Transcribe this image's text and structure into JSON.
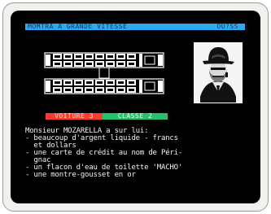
{
  "title_bar": {
    "title": "MOMTRA A GRANDE VITESSE",
    "right": "OU?SS",
    "color": "#2ea8ee"
  },
  "train": {
    "car_count": 2,
    "color": "#ffffff"
  },
  "portrait": {
    "icon": "detective-portrait-icon"
  },
  "badges": {
    "car": "VOITURE 3",
    "class": "CLASSE 2",
    "car_color": "#ff3b30",
    "class_color": "#27c26b"
  },
  "description": {
    "lines": [
      "Monsieur MOZARELLA a sur lui:",
      "- beaucoup d'argent liquide - francs",
      "  et dollars",
      "- une carte de crédit au nom de Péri-",
      "  gnac",
      "- un flacon d'eau de toilette 'MACHO'",
      "- une montre-gousset en or"
    ]
  }
}
